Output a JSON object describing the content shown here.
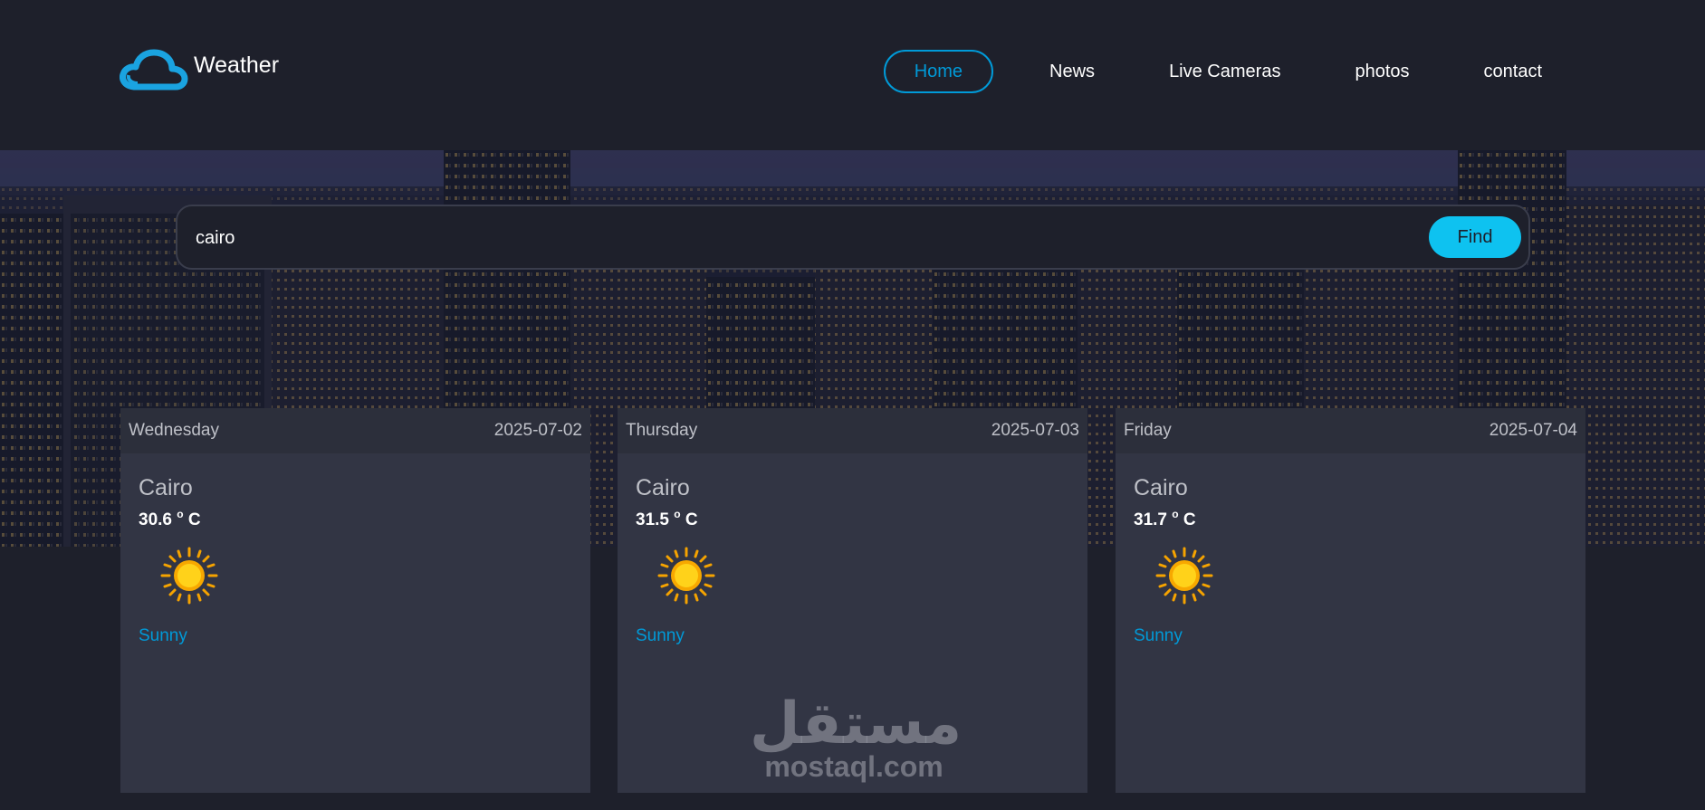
{
  "brand": {
    "name": "Weather"
  },
  "nav": {
    "items": [
      {
        "label": "Home",
        "active": true
      },
      {
        "label": "News"
      },
      {
        "label": "Live Cameras"
      },
      {
        "label": "photos"
      },
      {
        "label": "contact"
      }
    ]
  },
  "search": {
    "value": "cairo",
    "button_label": "Find"
  },
  "forecast": [
    {
      "day": "Wednesday",
      "date": "2025-07-02",
      "city": "Cairo",
      "temp": "30.6",
      "unit": "C",
      "condition": "Sunny",
      "icon": "sun-icon"
    },
    {
      "day": "Thursday",
      "date": "2025-07-03",
      "city": "Cairo",
      "temp": "31.5",
      "unit": "C",
      "condition": "Sunny",
      "icon": "sun-icon"
    },
    {
      "day": "Friday",
      "date": "2025-07-04",
      "city": "Cairo",
      "temp": "31.7",
      "unit": "C",
      "condition": "Sunny",
      "icon": "sun-icon"
    }
  ],
  "watermark": {
    "arabic": "مستقل",
    "latin": "mostaql.com"
  },
  "colors": {
    "accent": "#009ad8",
    "button": "#0ec2f0",
    "background": "#1e202b",
    "card": "#323544"
  }
}
